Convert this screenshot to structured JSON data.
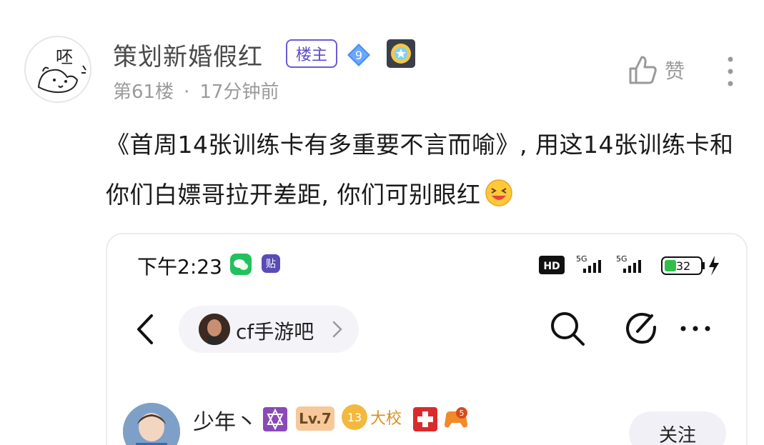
{
  "post": {
    "avatar_char": "呸",
    "username": "策划新婚假红",
    "owner_badge": "楼主",
    "level": "9",
    "floor": "第61楼",
    "separator": "·",
    "time": "17分钟前",
    "like_label": "赞",
    "text": "《首周14张训练卡有多重要不言而喻》, 用这14张训练卡和你们白嫖哥拉开差距, 你们可别眼红"
  },
  "embedded": {
    "status_time": "下午2:23",
    "tieba_icon": "贴",
    "battery": "32",
    "forum_name": "cf手游吧",
    "reply": {
      "name": "少年丶",
      "level": "Lv.7",
      "rank_num": "13",
      "rank_label": "大校",
      "game_num": "5",
      "follow_label": "关注"
    }
  },
  "icons": [
    "avatar",
    "level-diamond-icon",
    "medal-icon",
    "thumbs-up-icon",
    "more-vertical-icon",
    "laugh-emoji-icon",
    "wechat-icon",
    "tieba-icon",
    "hd-icon",
    "signal-5g-icon",
    "battery-icon",
    "charging-icon",
    "back-icon",
    "chevron-right-icon",
    "search-icon",
    "edit-icon",
    "more-horizontal-icon"
  ],
  "colors": {
    "badge_purple": "#5a4bc8",
    "meta_gray": "#9a9a9a",
    "wechat_green": "#22c15e",
    "diamond_blue": "#4a8ff0"
  }
}
